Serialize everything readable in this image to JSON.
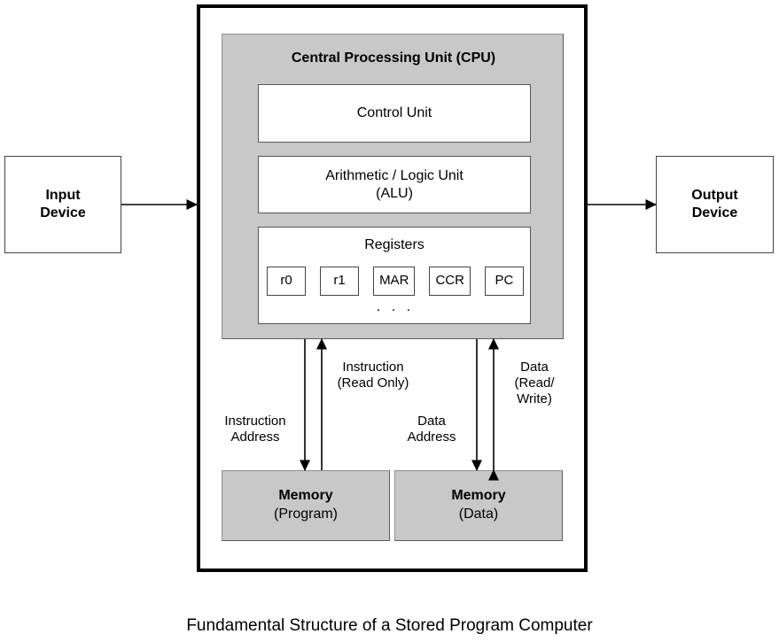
{
  "caption": "Fundamental Structure of a Stored Program Computer",
  "cpu": {
    "title": "Central Processing Unit (CPU)",
    "control_unit": "Control Unit",
    "alu_line1": "Arithmetic / Logic Unit",
    "alu_line2": "(ALU)",
    "registers_title": "Registers",
    "registers": [
      "r0",
      "r1",
      "MAR",
      "CCR",
      "PC"
    ],
    "registers_ellipsis": ". . ."
  },
  "io": {
    "input_line1": "Input",
    "input_line2": "Device",
    "output_line1": "Output",
    "output_line2": "Device"
  },
  "memory": {
    "program_title": "Memory",
    "program_subtitle": "(Program)",
    "data_title": "Memory",
    "data_subtitle": "(Data)"
  },
  "arrows": {
    "instruction_address": "Instruction\nAddress",
    "instruction_read": "Instruction\n(Read Only)",
    "data_address": "Data\nAddress",
    "data_readwrite": "Data\n(Read/\nWrite)"
  },
  "colors": {
    "panel_gray": "#c8c8c8",
    "outline_black": "#000000",
    "box_white": "#ffffff",
    "border_gray": "#555555"
  }
}
